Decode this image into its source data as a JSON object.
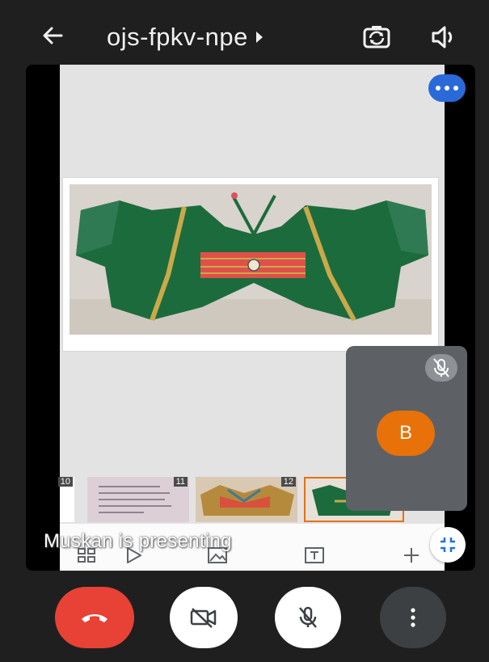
{
  "header": {
    "meeting_code": "ojs-fpkv-npe",
    "back_icon": "arrow-left-icon",
    "switch_camera_icon": "switch-camera-icon",
    "audio_icon": "speaker-icon"
  },
  "presentation": {
    "presenter_label": "Muskan is presenting",
    "slide_thumbnails": [
      {
        "number": "10"
      },
      {
        "number": "11"
      },
      {
        "number": "12"
      },
      {
        "number": "",
        "selected": true
      }
    ],
    "toolbar_icons": [
      "layout-icon",
      "play-icon",
      "image-icon",
      "text-box-icon",
      "add-icon"
    ]
  },
  "participant_tile": {
    "avatar_initial": "B",
    "avatar_color": "#e8710a",
    "muted": true
  },
  "controls": {
    "end_call_color": "#e84135",
    "buttons": [
      "end-call-icon",
      "camera-off-icon",
      "mic-off-icon",
      "more-vert-icon"
    ]
  },
  "colors": {
    "accent_blue": "#2a6ad8",
    "background": "#1f1f1f"
  }
}
